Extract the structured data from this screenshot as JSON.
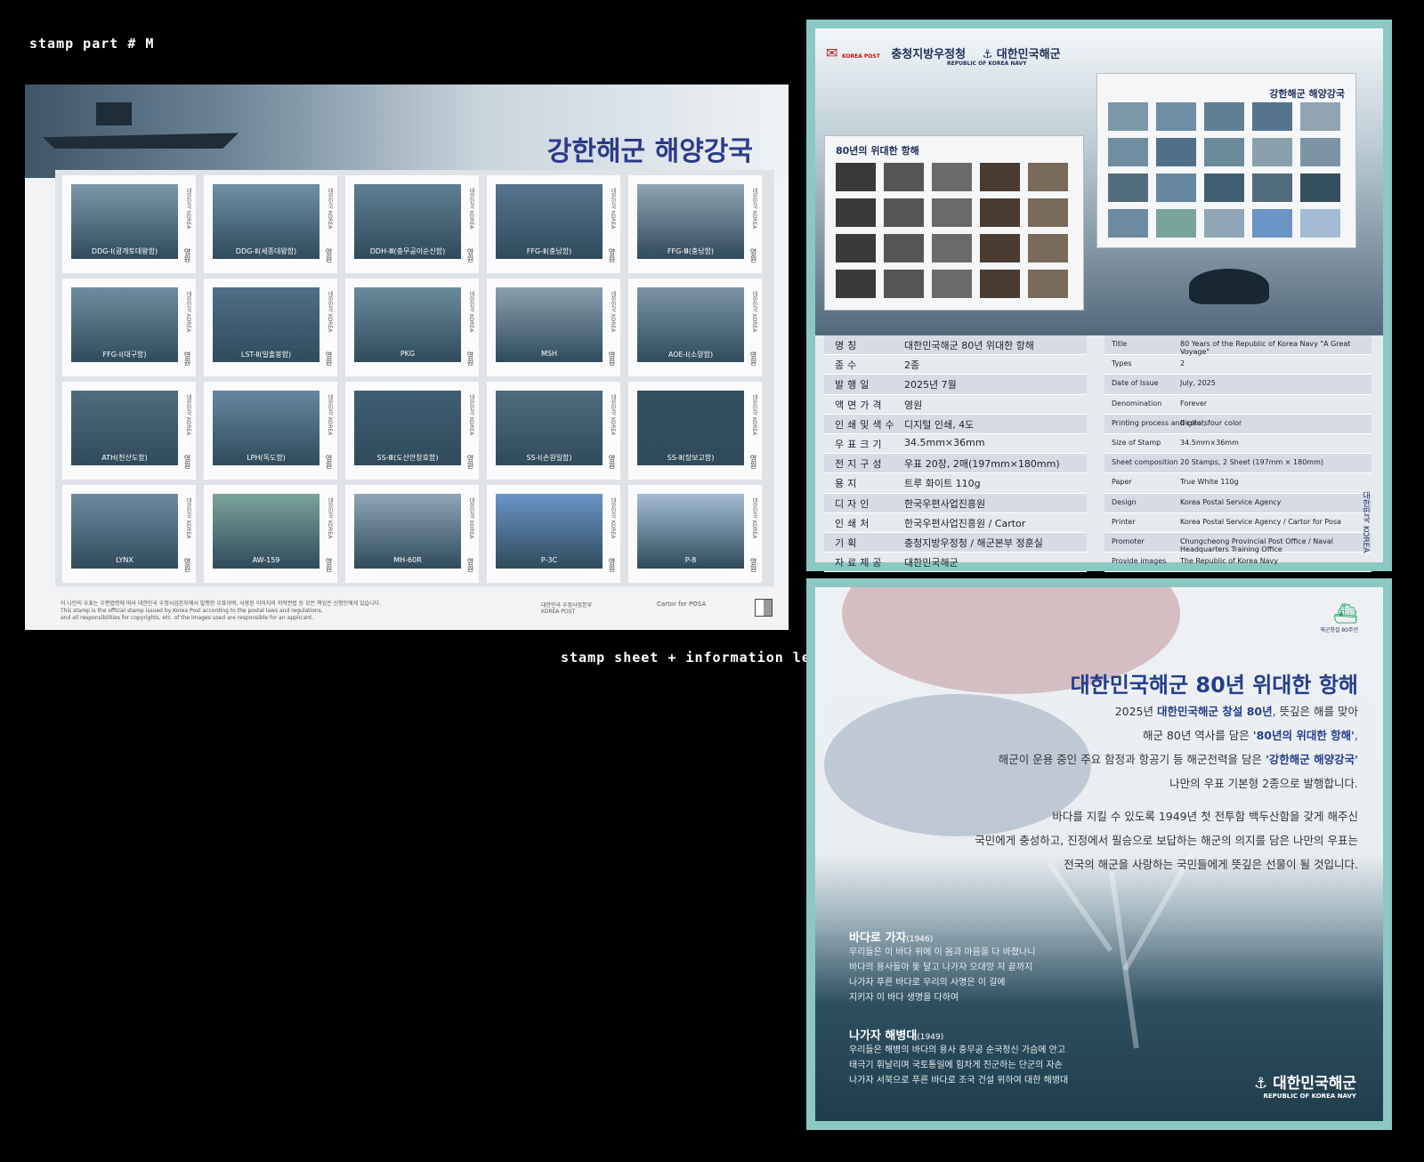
{
  "captions": {
    "top": "stamp part # M",
    "bottom": "stamp sheet + information leaflet"
  },
  "sheet": {
    "title": "강한해군 해양강국",
    "country": "대한민국 KOREA",
    "value": "영원",
    "stamps": [
      {
        "label": "DDG-Ⅰ(광개토대왕함)",
        "color": "#7c97a8"
      },
      {
        "label": "DDG-Ⅱ(세종대왕함)",
        "color": "#6e8fa6"
      },
      {
        "label": "DDH-Ⅲ(충무공이순신함)",
        "color": "#5e7f92"
      },
      {
        "label": "FFG-Ⅱ(충남함)",
        "color": "#56748e"
      },
      {
        "label": "FFG-Ⅲ(충남함)",
        "color": "#90a4b2"
      },
      {
        "label": "FFG-Ⅰ(대구함)",
        "color": "#6f8da0"
      },
      {
        "label": "LST-Ⅱ(일출봉함)",
        "color": "#4f6f88"
      },
      {
        "label": "PKG",
        "color": "#6a8b9c"
      },
      {
        "label": "MSH",
        "color": "#8aa0ad"
      },
      {
        "label": "AOE-Ⅰ(소양함)",
        "color": "#7b95a5"
      },
      {
        "label": "ATH(천산도함)",
        "color": "#506c7c"
      },
      {
        "label": "LPH(독도함)",
        "color": "#6587a0"
      },
      {
        "label": "SS-Ⅲ(도산안창호함)",
        "color": "#3f5e72"
      },
      {
        "label": "SS-Ⅰ(손원일함)",
        "color": "#4f6b7d"
      },
      {
        "label": "SS-Ⅱ(장보고함)",
        "color": "#34505f"
      },
      {
        "label": "LYNX",
        "color": "#6d8aa0"
      },
      {
        "label": "AW-159",
        "color": "#7aa49a"
      },
      {
        "label": "MH-60R",
        "color": "#8ea6b6"
      },
      {
        "label": "P-3C",
        "color": "#6b94c7"
      },
      {
        "label": "P-8",
        "color": "#a3bcd3"
      }
    ],
    "footer_kr": "이 나만의 우표는 우편법령에 따라 대한민국 우정사업본부에서 발행한 우표이며, 사용된 이미지의 저작권법 등 모든 책임은 신청인에게 있습니다.",
    "footer_en_1": "This stamp is the official stamp issued by Korea Post according to the postal laws and regulations,",
    "footer_en_2": "and all responsibilities for copyrights, etc. of the images used are responsible for an applicant.",
    "post": "대한민국 우정사업본부",
    "post_en": "KOREA POST",
    "printer": "Cartor for POSA"
  },
  "leaflet_front": {
    "korea_post": "KOREA POST",
    "office": "충청지방우정청",
    "navy": "대한민국해군",
    "navy_en": "REPUBLIC OF KOREA NAVY",
    "sheet1_title": "80년의 위대한 항해",
    "sheet2_title": "강한해군 해양강국",
    "rows_kr": [
      {
        "k": "명칭",
        "v": "대한민국해군 80년 위대한 항해"
      },
      {
        "k": "종수",
        "v": "2종"
      },
      {
        "k": "발행일",
        "v": "2025년 7월"
      },
      {
        "k": "액면가격",
        "v": "영원"
      },
      {
        "k": "인쇄및색수",
        "v": "디지털 인쇄, 4도"
      },
      {
        "k": "우표크기",
        "v": "34.5mm×36mm"
      },
      {
        "k": "전지구성",
        "v": "우표 20장, 2매(197mm×180mm)"
      },
      {
        "k": "용지",
        "v": "트루 화이트 110g"
      },
      {
        "k": "디자인",
        "v": "한국우편사업진흥원"
      },
      {
        "k": "인쇄처",
        "v": "한국우편사업진흥원 / Cartor"
      },
      {
        "k": "기획",
        "v": "충청지방우정청 / 해군본부 정훈실"
      },
      {
        "k": "자료제공",
        "v": "대한민국해군"
      }
    ],
    "rows_en": [
      {
        "k": "Title",
        "v": "80 Years of the Republic of Korea Navy \"A Great Voyage\""
      },
      {
        "k": "Types",
        "v": "2"
      },
      {
        "k": "Date of Issue",
        "v": "July, 2025"
      },
      {
        "k": "Denomination",
        "v": "Forever"
      },
      {
        "k": "Printing process and colors",
        "v": "Digital, four color"
      },
      {
        "k": "Size of Stamp",
        "v": "34.5mm×36mm"
      },
      {
        "k": "Sheet composition",
        "v": "20 Stamps, 2 Sheet (197mm × 180mm)"
      },
      {
        "k": "Paper",
        "v": "True White 110g"
      },
      {
        "k": "Design",
        "v": "Korea Postal Service Agency"
      },
      {
        "k": "Printer",
        "v": "Korea Postal Service Agency / Cartor for Posa"
      },
      {
        "k": "Promoter",
        "v": "Chungcheong Provincial Post Office / Naval Headquarters Training Office"
      },
      {
        "k": "Provide images",
        "v": "The Republic of Korea Navy"
      }
    ],
    "side_label": "대한민국 KOREA"
  },
  "leaflet_back": {
    "emblem": "해군창설 80주년",
    "title": "대한민국해군 80년 위대한 항해",
    "p1_a": "2025년 ",
    "p1_b": "대한민국해군 창설 80년",
    "p1_c": ", 뜻깊은 해를 맞아",
    "p2_a": "해군 80년 역사를 담은 ",
    "p2_b": "'80년의 위대한 항해'",
    "p2_c": ",",
    "p3_a": "해군이 운용 중인 주요 함정과 항공기 등 해군전력을 담은 ",
    "p3_b": "'강한해군 해양강국'",
    "p4": "나만의 우표 기본형 2종으로 발행합니다.",
    "p5": "바다를 지킬 수 있도록 1949년 첫 전투함 백두산함을 갖게 해주신",
    "p6": "국민에게 충성하고, 진정에서 필승으로 보답하는 해군의 의지를 담은 나만의 우표는",
    "p7": "전국의 해군을 사랑하는 국민들에게 뜻깊은 선물이 될 것입니다.",
    "song1_title": "바다로 가자",
    "song1_year": "(1946)",
    "song1_lines": [
      "우리들은 이 바다 위에 이 몸과 마음을 다 바쳤나니",
      "바다의 용사들아 돛 달고 나가자 오대양 저 끝까지",
      "나가자 푸른 바다로 우리의 사명은 이 길에",
      "지키자 이 바다 생명을 다하여"
    ],
    "song2_title": "나가자 해병대",
    "song2_year": "(1949)",
    "song2_lines": [
      "우리들은 해병의 바다의 용사 충무공 순국정신 가슴에 안고",
      "태극기 휘날리며 국토통일에 힘차게 진군하는 단군의 자손",
      "나가자 서북으로 푸른 바다로 조국 건설 위하여 대한 해병대"
    ],
    "navy": "대한민국해군",
    "navy_en": "REPUBLIC OF KOREA NAVY"
  }
}
